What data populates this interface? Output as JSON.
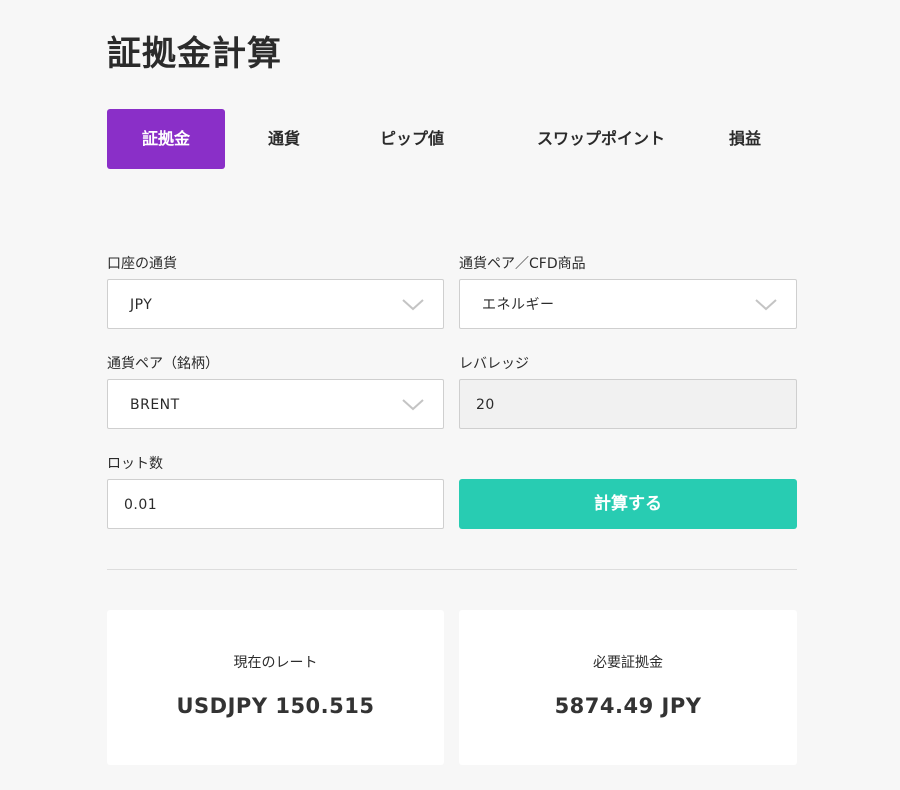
{
  "page": {
    "title": "証拠金計算"
  },
  "tabs": [
    {
      "label": "証拠金",
      "active": true
    },
    {
      "label": "通貨",
      "active": false
    },
    {
      "label": "ピップ値",
      "active": false
    },
    {
      "label": "スワップポイント",
      "active": false
    },
    {
      "label": "損益",
      "active": false
    }
  ],
  "form": {
    "account_currency": {
      "label": "口座の通貨",
      "value": "JPY",
      "icon": "chevron-down-icon"
    },
    "instrument_type": {
      "label": "通貨ペア／CFD商品",
      "value": "エネルギー",
      "icon": "chevron-down-icon"
    },
    "symbol": {
      "label": "通貨ペア（銘柄）",
      "value": "BRENT",
      "icon": "chevron-down-icon"
    },
    "leverage": {
      "label": "レバレッジ",
      "value": "20"
    },
    "lots": {
      "label": "ロット数",
      "value": "0.01"
    },
    "calculate_label": "計算する"
  },
  "results": {
    "current_rate": {
      "label": "現在のレート",
      "value": "USDJPY 150.515"
    },
    "required_margin": {
      "label": "必要証拠金",
      "value": "5874.49 JPY"
    }
  },
  "colors": {
    "accent": "#8a2fc8",
    "button": "#28ccb2",
    "background": "#f7f7f7"
  }
}
